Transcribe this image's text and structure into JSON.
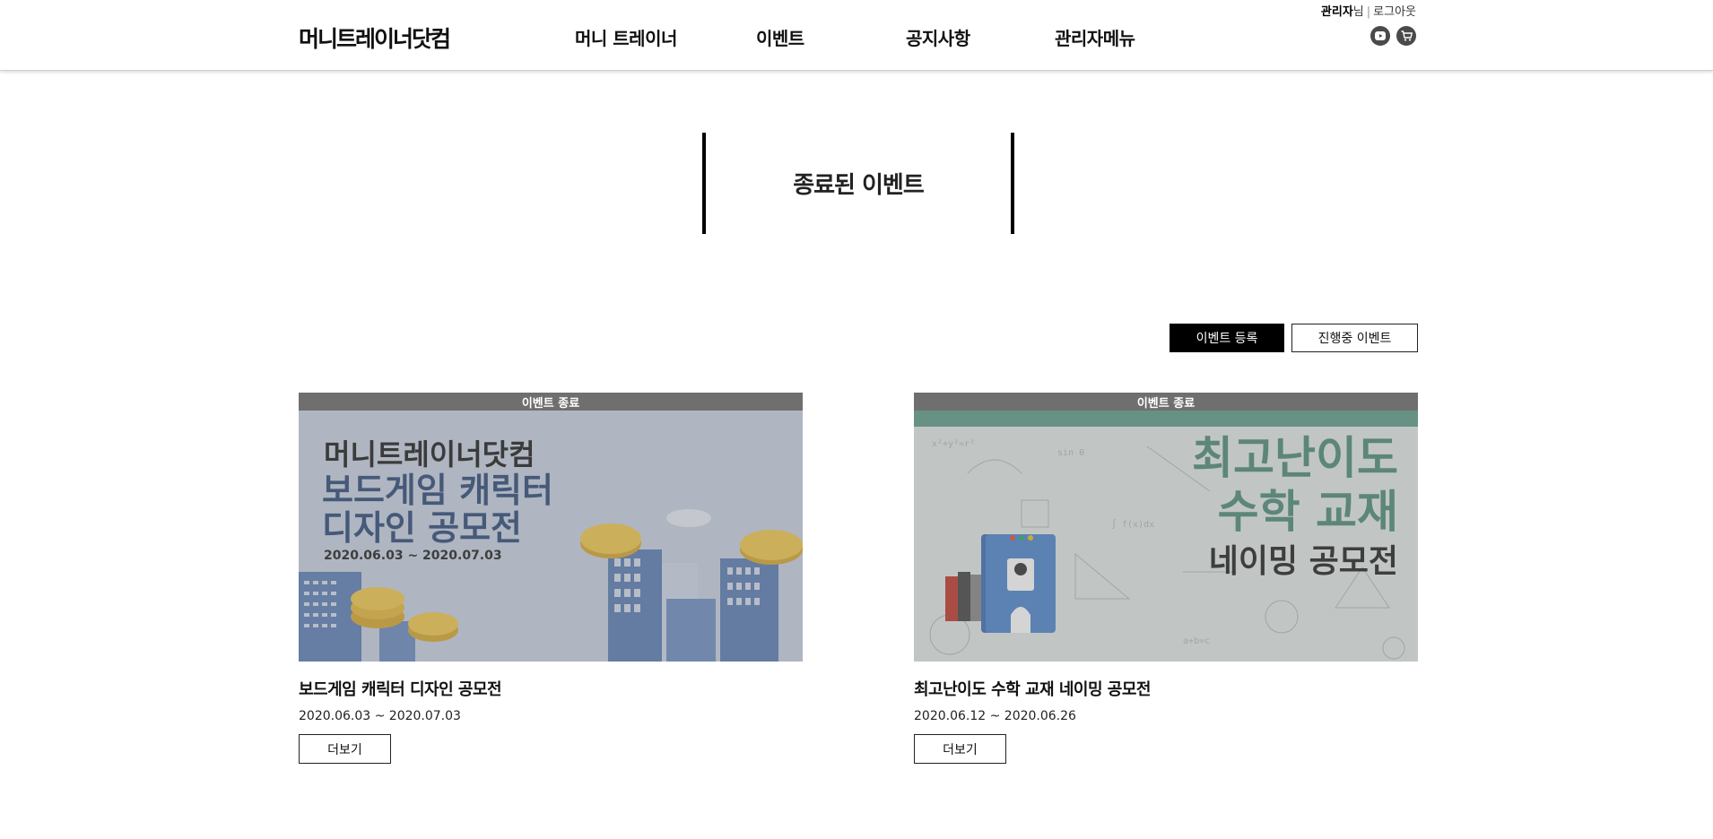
{
  "header": {
    "logo": "머니트레이너닷컴",
    "nav": [
      "머니 트레이너",
      "이벤트",
      "공지사항",
      "관리자메뉴"
    ],
    "user_name": "관리자",
    "user_suffix": "님",
    "separator": "|",
    "logout": "로그아웃",
    "icons": [
      "youtube-icon",
      "cart-icon"
    ]
  },
  "page": {
    "title": "종료된 이벤트"
  },
  "actions": {
    "register": "이벤트 등록",
    "ongoing": "진행중 이벤트"
  },
  "cards": [
    {
      "status": "이벤트 종료",
      "banner": {
        "line1": "머니트레이너닷컴",
        "line2": "보드게임 캐릭터",
        "line3": "디자인 공모전",
        "date": "2020.06.03 ~ 2020.07.03"
      },
      "title": "보드게임 캐릭터 디자인 공모전",
      "date": "2020.06.03 ~ 2020.07.03",
      "more": "더보기"
    },
    {
      "status": "이벤트 종료",
      "banner": {
        "line1": "최고난이도",
        "line2": "수학 교재",
        "line3": "네이밍 공모전"
      },
      "title": "최고난이도 수학 교재 네이밍 공모전",
      "date": "2020.06.12 ~ 2020.06.26",
      "more": "더보기"
    }
  ],
  "colors": {
    "accent": "#000000",
    "ended_bar": "#6f6f6f",
    "banner1_bg": "#c9d3e3",
    "banner1_text": "#2f4a7a",
    "banner2_bg": "#e4ebe7",
    "banner2_text": "#4f8c7a"
  }
}
